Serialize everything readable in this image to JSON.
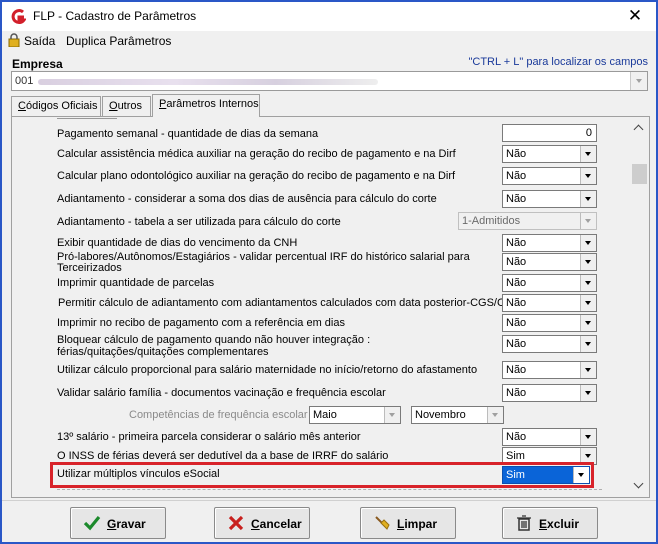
{
  "window": {
    "title": "FLP - Cadastro de Parâmetros",
    "close_glyph": "✕"
  },
  "menu": {
    "items": [
      "Saída",
      "Duplica Parâmetros"
    ]
  },
  "empresa": {
    "label": "Empresa",
    "hint": "\"CTRL + L\" para localizar os campos",
    "code": "001"
  },
  "tabs": [
    {
      "label": "Códigos Oficiais",
      "underline": "C",
      "rest": "ódigos Oficiais"
    },
    {
      "label": "Outros",
      "underline": "O",
      "rest": "utros"
    },
    {
      "label": "Parâmetros Internos",
      "underline": "P",
      "rest": "arâmetros Internos"
    }
  ],
  "rows": [
    {
      "label": "Pagamento semanal - quantidade de dias da  semana",
      "kind": "number",
      "value": "0"
    },
    {
      "label": "Calcular assistência médica auxiliar na geração do recibo de pagamento e na Dirf",
      "kind": "select",
      "value": "Não"
    },
    {
      "label": "Calcular plano odontológico auxiliar na geração do recibo de pagamento e na Dirf",
      "kind": "select",
      "value": "Não"
    },
    {
      "label": "Adiantamento - considerar a soma dos dias de ausência para cálculo do corte",
      "kind": "select",
      "value": "Não"
    },
    {
      "label": "Adiantamento - tabela a ser utilizada para cálculo do corte",
      "kind": "select-disabled",
      "value": "1-Admitidos"
    },
    {
      "label": "Exibir quantidade de dias do vencimento da CNH",
      "kind": "select",
      "value": "Não"
    },
    {
      "label": "Pró-labores/Autônomos/Estagiários - validar percentual IRF do  histórico salarial para",
      "label2": "Terceirizados",
      "kind": "select",
      "value": "Não"
    },
    {
      "label": "Imprimir quantidade de parcelas",
      "kind": "select",
      "value": "Não"
    },
    {
      "label": "Permitir cálculo de adiantamento com adiantamentos calculados com data posterior-CGS/CTE",
      "kind": "select",
      "value": "Não"
    },
    {
      "label": "Imprimir no recibo de pagamento com a referência em dias",
      "kind": "select",
      "value": "Não"
    },
    {
      "label": "Bloquear cálculo de pagamento quando não houver integração :",
      "label2": "férias/quitações/quitações complementares",
      "kind": "select",
      "value": "Não"
    },
    {
      "label": "Utilizar cálculo proporcional para salário maternidade no início/retorno do afastamento",
      "kind": "select",
      "value": "Não"
    },
    {
      "label": "Validar salário família - documentos vacinação e frequência escolar",
      "kind": "select",
      "value": "Não"
    },
    {
      "label": "Competências de frequência escolar",
      "kind": "months",
      "value": "Maio",
      "value2": "Novembro"
    },
    {
      "label": "13º salário - primeira parcela considerar o salário mês anterior",
      "kind": "select",
      "value": "Não"
    },
    {
      "label": "O INSS de férias deverá ser dedutível da a base de IRRF do salário",
      "kind": "select",
      "value": "Sim"
    },
    {
      "label": "Utilizar múltiplos vínculos eSocial",
      "kind": "select-selected",
      "value": "Sim"
    }
  ],
  "buttons": [
    {
      "label": "Gravar",
      "u": "G",
      "rest": "ravar",
      "icon": "check-icon",
      "color": "#1c8a2c"
    },
    {
      "label": "Cancelar",
      "u": "C",
      "rest": "ancelar",
      "icon": "x-icon",
      "color": "#c8201e"
    },
    {
      "label": "Limpar",
      "u": "L",
      "rest": "impar",
      "icon": "broom-icon",
      "color": "#e0b020"
    },
    {
      "label": "Excluir",
      "u": "E",
      "rest": "xcluir",
      "icon": "trash-icon",
      "color": "#333333"
    }
  ],
  "colors": {
    "accent": "#2a57c7",
    "highlight_border": "#d8232a",
    "selection": "#0a64d8"
  }
}
